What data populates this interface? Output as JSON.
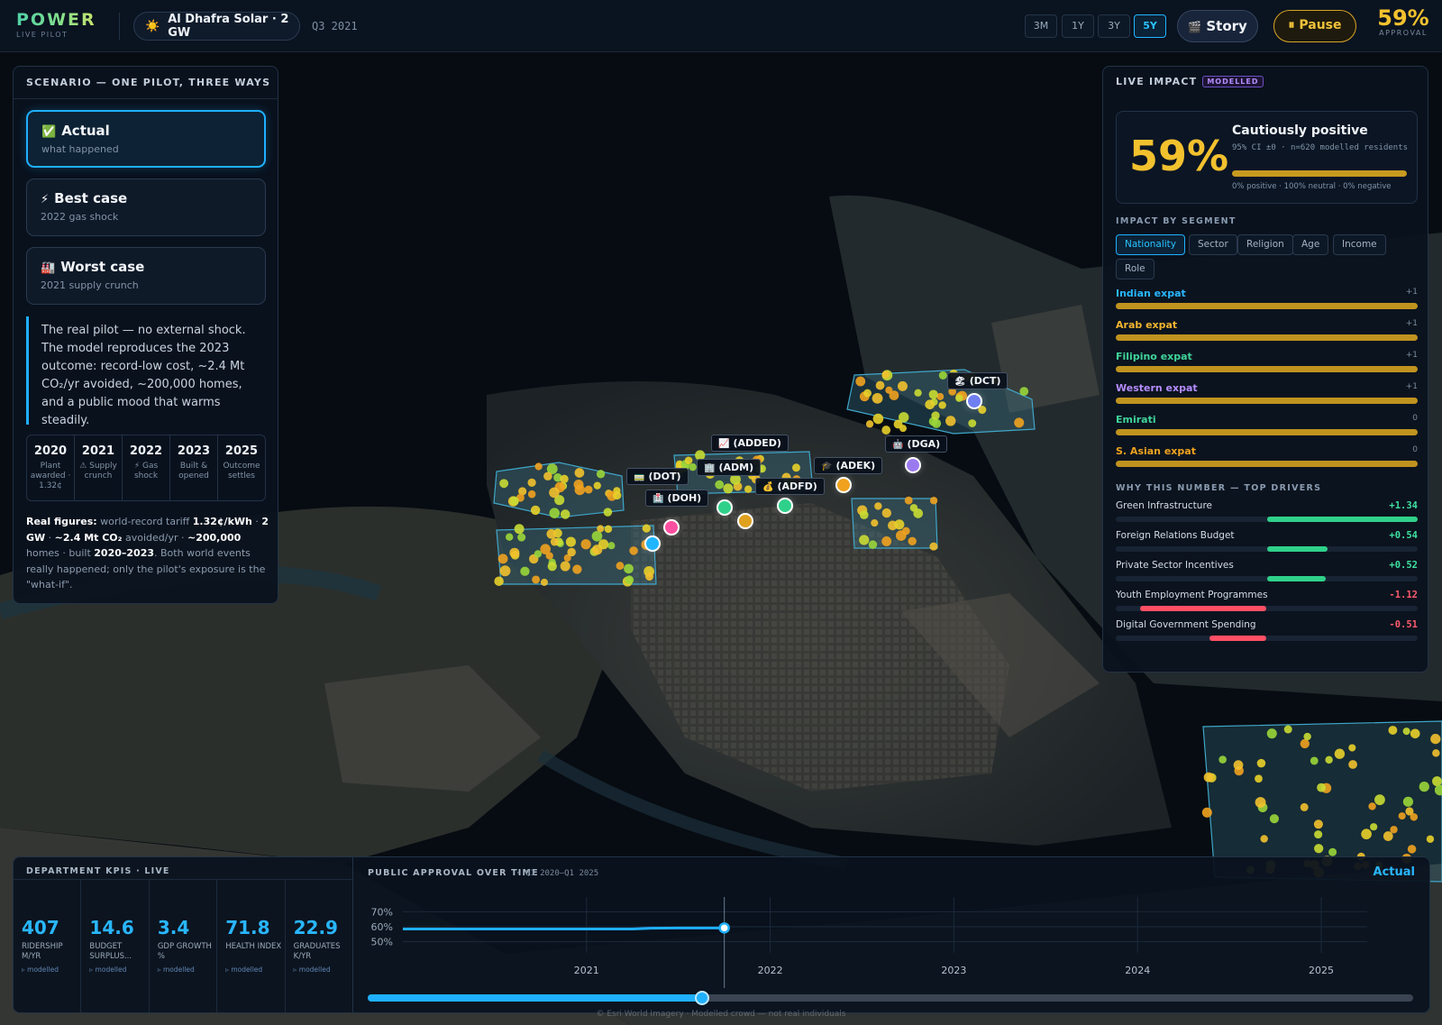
{
  "app": {
    "brand": "POWER",
    "brand_sub": "LIVE PILOT",
    "project_icon": "sun-icon",
    "project_emoji": "☀️",
    "project": "Al Dhafra Solar · 2 GW",
    "quarter": "Q3 2021"
  },
  "ranges": [
    "3M",
    "1Y",
    "3Y",
    "5Y"
  ],
  "active_range": "5Y",
  "story_label": "Story",
  "story_emoji": "🎬",
  "pause_label": "⏸ Pause",
  "approval": {
    "value": "59%",
    "label": "APPROVAL"
  },
  "scenario": {
    "title": "SCENARIO — ONE PILOT, THREE WAYS",
    "cards": [
      {
        "emoji": "✅",
        "title": "Actual",
        "subtitle": "what happened",
        "active": true
      },
      {
        "emoji": "⚡",
        "title": "Best case",
        "subtitle": "2022 gas shock",
        "active": false
      },
      {
        "emoji": "🏭",
        "title": "Worst case",
        "subtitle": "2021 supply crunch",
        "active": false
      }
    ],
    "description": "The real pilot — no external shock. The model reproduces the 2023 outcome: record-low cost, ~2.4 Mt CO₂/yr avoided, ~200,000 homes, and a public mood that warms steadily.",
    "timeline": [
      {
        "year": "2020",
        "desc": "Plant awarded · 1.32¢"
      },
      {
        "year": "2021",
        "desc": "⚠ Supply crunch"
      },
      {
        "year": "2022",
        "desc": "⚡ Gas shock"
      },
      {
        "year": "2023",
        "desc": "Built & opened"
      },
      {
        "year": "2025",
        "desc": "Outcome settles"
      }
    ],
    "real_figures": {
      "p1": "Real figures:",
      "p2": " world-record tariff ",
      "p3": "1.32¢/kWh",
      "p4": " · ",
      "p5": "2 GW",
      "p6": " · ",
      "p7": "~2.4 Mt CO₂",
      "p8": " avoided/yr · ",
      "p9": "~200,000",
      "p10": " homes · built ",
      "p11": "2020–2023",
      "p12": ". Both world events really happened; only the pilot's exposure is the \"what-if\"."
    }
  },
  "map": {
    "pins": [
      {
        "code": "(DCT)",
        "emoji": "🏖",
        "color": "#6f7ff0"
      },
      {
        "code": "(ADDED)",
        "emoji": "📈",
        "color": "#2fd18a"
      },
      {
        "code": "(DGA)",
        "emoji": "🤖",
        "color": "#9b7af0"
      },
      {
        "code": "(ADM)",
        "emoji": "🏢",
        "color": "#e0a11f"
      },
      {
        "code": "(ADEK)",
        "emoji": "🎓",
        "color": "#f0a21f"
      },
      {
        "code": "(ADFD)",
        "emoji": "💰",
        "color": "#2fd18a"
      },
      {
        "code": "(DOT)",
        "emoji": "🚃",
        "color": "#1fb6ff"
      },
      {
        "code": "(DOH)",
        "emoji": "🏥",
        "color": "#ff4fa0"
      }
    ],
    "credit": "© Esri World Imagery · Modelled crowd — not real individuals"
  },
  "impact": {
    "title": "LIVE IMPACT",
    "badge": "MODELLED",
    "big": "59%",
    "mood": "Cautiously positive",
    "ci": "95% CI ±0 · n=620 modelled residents",
    "split": "0% positive · 100% neutral · 0% negative",
    "segment_title": "IMPACT BY SEGMENT",
    "segment_tabs": [
      "Nationality",
      "Sector",
      "Religion",
      "Age",
      "Income",
      "Role"
    ],
    "active_tab": "Nationality",
    "segments": [
      {
        "name": "Indian expat",
        "value": "+1",
        "color": "#29b6ff",
        "fill": 1.0
      },
      {
        "name": "Arab expat",
        "value": "+1",
        "color": "#f2b530",
        "fill": 1.0
      },
      {
        "name": "Filipino expat",
        "value": "+1",
        "color": "#3fd39a",
        "fill": 1.0
      },
      {
        "name": "Western expat",
        "value": "+1",
        "color": "#b48cff",
        "fill": 1.0
      },
      {
        "name": "Emirati",
        "value": "0",
        "color": "#3fd39a",
        "fill": 1.0
      },
      {
        "name": "S. Asian expat",
        "value": "0",
        "color": "#f0a21f",
        "fill": 1.0
      }
    ],
    "drivers_title": "WHY THIS NUMBER — TOP DRIVERS",
    "drivers": [
      {
        "name": "Green Infrastructure",
        "value": "+1.34",
        "color": "#2fd18a",
        "value_color": "#3fe0a0",
        "start": 0.5,
        "end": 1.0
      },
      {
        "name": "Foreign Relations Budget",
        "value": "+0.54",
        "color": "#2fd18a",
        "value_color": "#3fe0a0",
        "start": 0.5,
        "end": 0.7
      },
      {
        "name": "Private Sector Incentives",
        "value": "+0.52",
        "color": "#2fd18a",
        "value_color": "#3fe0a0",
        "start": 0.5,
        "end": 0.695
      },
      {
        "name": "Youth Employment Programmes",
        "value": "-1.12",
        "color": "#ff4f64",
        "value_color": "#ff5a6e",
        "start": 0.08,
        "end": 0.5
      },
      {
        "name": "Digital Government Spending",
        "value": "-0.51",
        "color": "#ff4f64",
        "value_color": "#ff5a6e",
        "start": 0.31,
        "end": 0.5
      }
    ]
  },
  "kpis": {
    "title": "DEPARTMENT KPIS · LIVE",
    "items": [
      {
        "value": "407",
        "label": "RIDERSHIP M/YR",
        "meta": "▹ modelled"
      },
      {
        "value": "14.6",
        "label": "BUDGET SURPLUS...",
        "meta": "▹ modelled"
      },
      {
        "value": "3.4",
        "label": "GDP GROWTH %",
        "meta": "▹ modelled"
      },
      {
        "value": "71.8",
        "label": "HEALTH INDEX",
        "meta": "▹ modelled"
      },
      {
        "value": "22.9",
        "label": "GRADUATES K/YR",
        "meta": "▹ modelled"
      }
    ]
  },
  "chart_data": {
    "type": "line",
    "title": "PUBLIC APPROVAL OVER TIME",
    "subtitle": "· Q1 2020–Q1 2025",
    "scenario_label": "Actual",
    "x_ticks": [
      "2021",
      "2022",
      "2023",
      "2024",
      "2025"
    ],
    "y_ticks": [
      "70%",
      "60%",
      "50%"
    ],
    "xlim": [
      2020.0,
      2025.25
    ],
    "ylim": [
      45,
      75
    ],
    "series": [
      {
        "values_x": [
          2020.0,
          2020.5,
          2021.0,
          2021.25,
          2021.35,
          2021.5,
          2021.75
        ],
        "values_y": [
          58.5,
          58.5,
          58.5,
          58.5,
          59.0,
          59.2,
          59.2
        ]
      }
    ],
    "cursor_x": 2021.75,
    "grid": true,
    "progress": 0.32
  }
}
